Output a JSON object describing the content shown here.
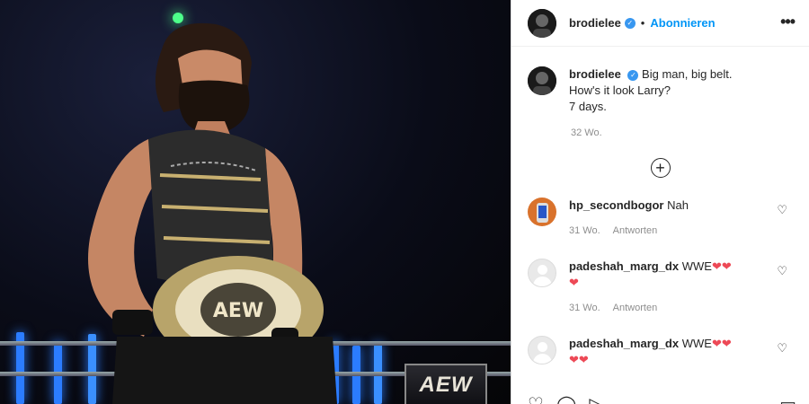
{
  "post": {
    "username": "brodielee",
    "follow_label": "Abonnieren",
    "dot": "•",
    "more_icon": "•••",
    "banner_text": "AEW"
  },
  "caption": {
    "username": "brodielee",
    "lines": [
      "Big man, big belt.",
      "How's it look Larry?",
      "7 days."
    ],
    "time": "32 Wo."
  },
  "load_more_icon": "+",
  "comments": [
    {
      "username": "hp_secondbogor",
      "text": "Nah",
      "hearts": "",
      "time": "31 Wo.",
      "reply": "Antworten"
    },
    {
      "username": "padeshah_marg_dx",
      "text": "WWE",
      "hearts": "❤❤",
      "time": "31 Wo.",
      "reply": "Antworten",
      "hearts2": "❤"
    },
    {
      "username": "padeshah_marg_dx",
      "text": "WWE",
      "hearts": "❤❤",
      "hearts2": "❤❤"
    }
  ],
  "icons": {
    "like": "♡",
    "comment": "◯",
    "share": "▷",
    "bookmark": "▭",
    "verified": "✓"
  },
  "colors": {
    "verified": "#3897f0",
    "link": "#0095f6",
    "heart": "#ed4956",
    "meta": "#8e8e8e"
  }
}
